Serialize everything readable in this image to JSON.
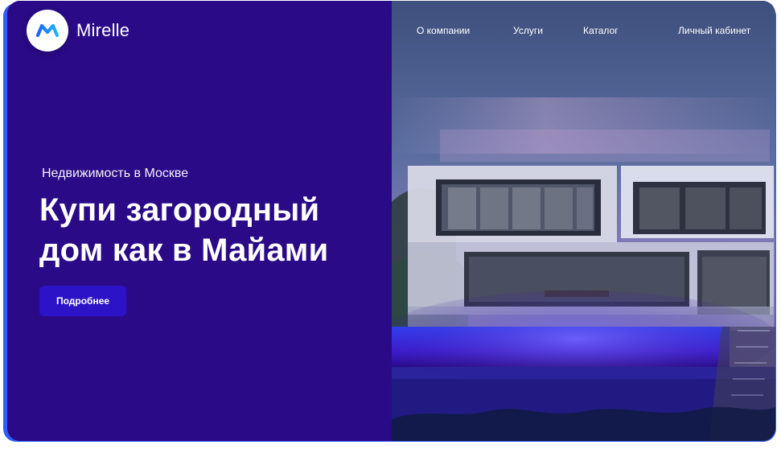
{
  "brand": {
    "name": "Mirelle",
    "logo_icon": "m-logo-icon",
    "accent": "#2a0a86"
  },
  "nav": {
    "items": [
      {
        "label": "О компании",
        "name": "nav-item-about"
      },
      {
        "label": "Услуги",
        "name": "nav-item-services"
      },
      {
        "label": "Каталог",
        "name": "nav-item-catalog"
      },
      {
        "label": "Личный кабинет",
        "name": "nav-item-account"
      }
    ]
  },
  "hero": {
    "kicker": "Недвижимость в Москве",
    "title_line1": "Купи загородный",
    "title_line2": "дом как в Майами",
    "cta_label": "Подробнее"
  },
  "colors": {
    "left_panel": "#2a0a86",
    "button": "#2c13c7",
    "text": "#ffffff",
    "edge": "#2f5bff"
  }
}
